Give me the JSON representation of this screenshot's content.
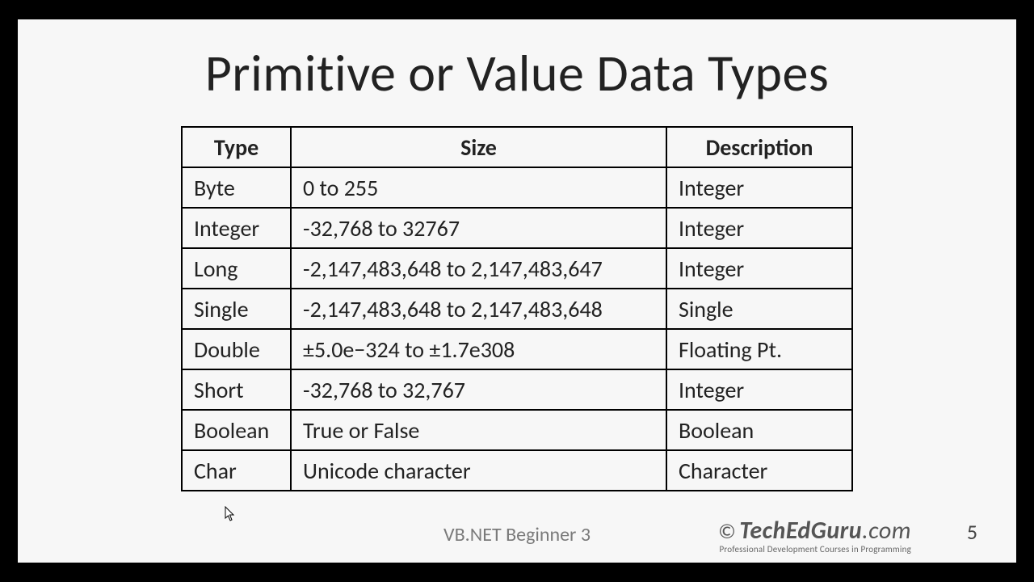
{
  "title": "Primitive or Value Data Types",
  "table": {
    "headers": [
      "Type",
      "Size",
      "Description"
    ],
    "rows": [
      {
        "type": "Byte",
        "size": "0 to 255",
        "desc": "Integer"
      },
      {
        "type": "Integer",
        "size": "-32,768 to 32767",
        "desc": "Integer"
      },
      {
        "type": "Long",
        "size": "-2,147,483,648 to 2,147,483,647",
        "desc": "Integer"
      },
      {
        "type": "Single",
        "size": "-2,147,483,648 to 2,147,483,648",
        "desc": "Single"
      },
      {
        "type": "Double",
        "size": "±5.0e−324 to ±1.7e308",
        "desc": "Floating Pt."
      },
      {
        "type": "Short",
        "size": "-32,768 to 32,767",
        "desc": "Integer"
      },
      {
        "type": "Boolean",
        "size": "True or False",
        "desc": "Boolean"
      },
      {
        "type": "Char",
        "size": "Unicode character",
        "desc": "Character"
      }
    ]
  },
  "footer": {
    "subtitle": "VB.NET Beginner 3",
    "brand_copy": "©",
    "brand_bold": "TechEdGuru",
    "brand_domain": ".com",
    "brand_tag": "Professional Development Courses in Programming",
    "page": "5"
  }
}
